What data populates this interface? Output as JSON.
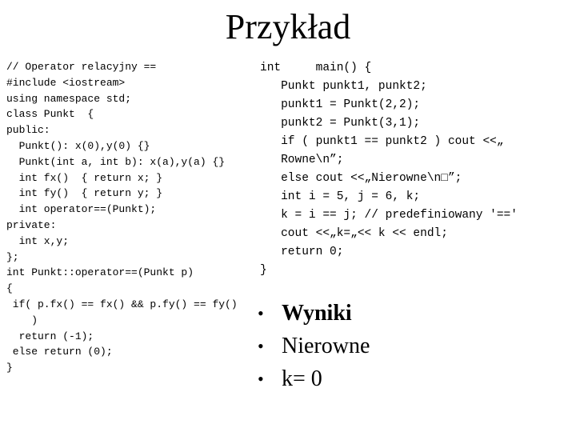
{
  "slide": {
    "title": "Przykład",
    "left_code": [
      "// Operator relacyjny ==",
      "#include <iostream>",
      "using namespace std;",
      "class Punkt  {",
      "public:",
      "  Punkt(): x(0),y(0) {}",
      "  Punkt(int a, int b): x(a),y(a) {}",
      "  int fx()  { return x; }",
      "  int fy()  { return y; }",
      "  int operator==(Punkt);",
      "private:",
      "  int x,y;",
      "};",
      "int Punkt::operator==(Punkt p)",
      "{",
      " if( p.fx() == fx() && p.fy() == fy()",
      "    )",
      "  return (-1);",
      " else return (0);",
      "}"
    ],
    "right_code": [
      "int     main() {",
      "   Punkt punkt1, punkt2;",
      "   punkt1 = Punkt(2,2);",
      "   punkt2 = Punkt(3,1);",
      "   if ( punkt1 == punkt2 ) cout <<„",
      "   Rowne\\n”;",
      "   else cout <<„Nierowne\\n□”;",
      "   int i = 5, j = 6, k;",
      "   k = i == j; // predefiniowany '=='",
      "   cout <<„k=„<< k << endl;",
      "   return 0;",
      "}"
    ],
    "results": {
      "bullet_icon": "•",
      "items": [
        {
          "text": "Wyniki",
          "bold": true
        },
        {
          "text": "Nierowne",
          "bold": false
        },
        {
          "text": "k= 0",
          "bold": false
        }
      ]
    }
  }
}
